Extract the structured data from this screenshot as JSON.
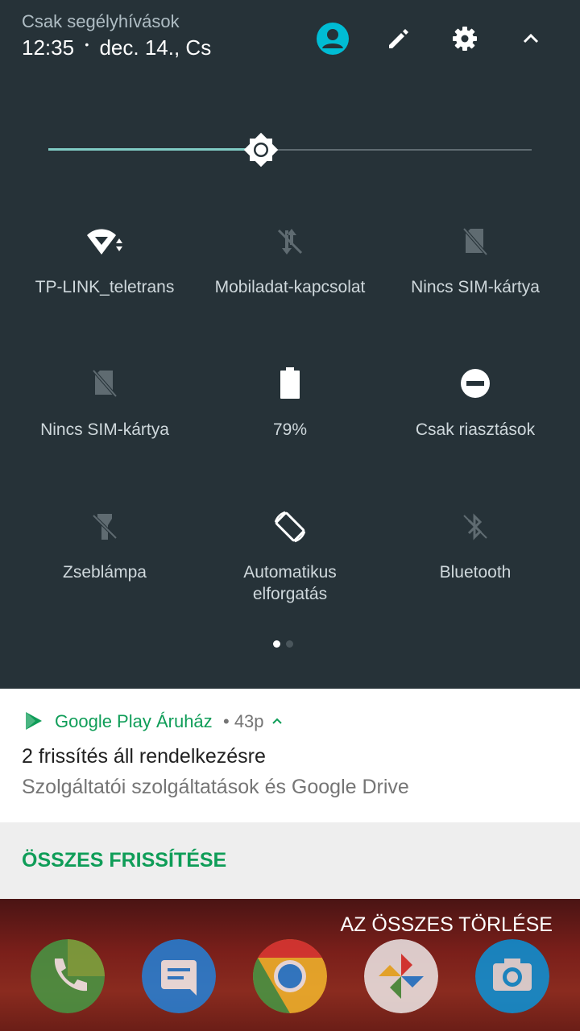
{
  "header": {
    "carrier_text": "Csak segélyhívások",
    "time": "12:35",
    "separator": "•",
    "date": "dec. 14., Cs",
    "buttons": [
      "user-icon",
      "pencil-icon",
      "gear-icon",
      "chevron-up-icon"
    ]
  },
  "brightness": {
    "level": 0.44
  },
  "tiles": [
    {
      "label": "TP-LINK_teletrans",
      "icon": "wifi-icon",
      "active": true
    },
    {
      "label": "Mobiladat-kapcsolat",
      "icon": "mobile-data-off-icon",
      "active": false
    },
    {
      "label": "Nincs SIM-kártya",
      "icon": "no-sim-icon",
      "active": false
    },
    {
      "label": "Nincs SIM-kártya",
      "icon": "no-sim-icon",
      "active": false
    },
    {
      "label": "79%",
      "icon": "battery-icon",
      "active": true
    },
    {
      "label": "Csak riasztások",
      "icon": "do-not-disturb-icon",
      "active": true
    },
    {
      "label": "Zseblámpa",
      "icon": "flashlight-off-icon",
      "active": false
    },
    {
      "label": "Automatikus\nelforgatás",
      "icon": "auto-rotate-icon",
      "active": true
    },
    {
      "label": "Bluetooth",
      "icon": "bluetooth-off-icon",
      "active": false
    }
  ],
  "pager": {
    "pages": 2,
    "current": 1
  },
  "notification": {
    "app_name": "Google Play Áruház",
    "meta": "• 43p",
    "title": "2 frissítés áll rendelkezésre",
    "text": "Szolgáltatói szolgáltatások és Google Drive",
    "action": "ÖSSZES FRISSÍTÉSE",
    "accent": "#0f9d58"
  },
  "clear_all": "AZ ÖSSZES TÖRLÉSE",
  "dock": [
    "phone-icon",
    "messages-icon",
    "chrome-icon",
    "photos-icon",
    "camera-icon"
  ],
  "colors": {
    "shade_bg": "#263238",
    "accent_teal": "#80cbc4",
    "inactive": "#5f6b71"
  }
}
